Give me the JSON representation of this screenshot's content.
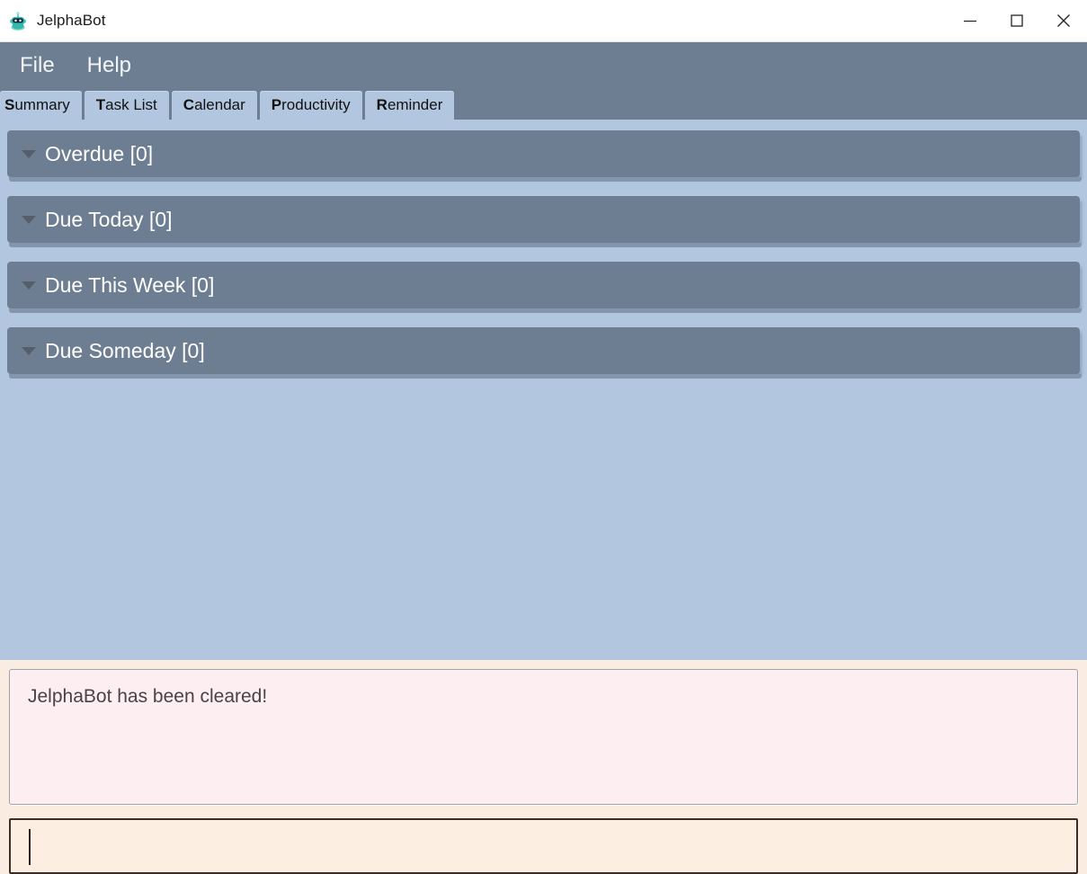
{
  "window": {
    "title": "JelphaBot",
    "icon": "robot-icon",
    "controls": [
      {
        "name": "minimize",
        "glyph": "minimize-icon"
      },
      {
        "name": "maximize",
        "glyph": "maximize-icon"
      },
      {
        "name": "close",
        "glyph": "close-icon"
      }
    ]
  },
  "menu": {
    "items": [
      {
        "label": "File",
        "mnemonic": "F"
      },
      {
        "label": "Help",
        "mnemonic": "H"
      }
    ]
  },
  "tabs": {
    "active": "Summary",
    "items": [
      {
        "mnemonic": "S",
        "rest": "ummary",
        "label": "Summary"
      },
      {
        "mnemonic": "T",
        "rest": "ask List",
        "label": "Task List"
      },
      {
        "mnemonic": "C",
        "rest": "alendar",
        "label": "Calendar"
      },
      {
        "mnemonic": "P",
        "rest": "roductivity",
        "label": "Productivity"
      },
      {
        "mnemonic": "R",
        "rest": "eminder",
        "label": "Reminder"
      }
    ]
  },
  "summary": {
    "groups": [
      {
        "title": "Overdue [0]",
        "count": 0,
        "expanded": true
      },
      {
        "title": "Due Today [0]",
        "count": 0,
        "expanded": true
      },
      {
        "title": "Due This Week [0]",
        "count": 0,
        "expanded": true
      },
      {
        "title": "Due Someday [0]",
        "count": 0,
        "expanded": true
      }
    ]
  },
  "output": {
    "message": "JelphaBot has been cleared!"
  },
  "input": {
    "value": "",
    "placeholder": ""
  },
  "colors": {
    "menu_bar": "#6e7e92",
    "content_bg": "#b2c6e0",
    "tab_bg": "#b2c6e0",
    "group_header": "#6e7e92",
    "output_bg": "#fdeef1",
    "bottom_bg": "#fbece2",
    "input_border": "#3b2d28"
  }
}
